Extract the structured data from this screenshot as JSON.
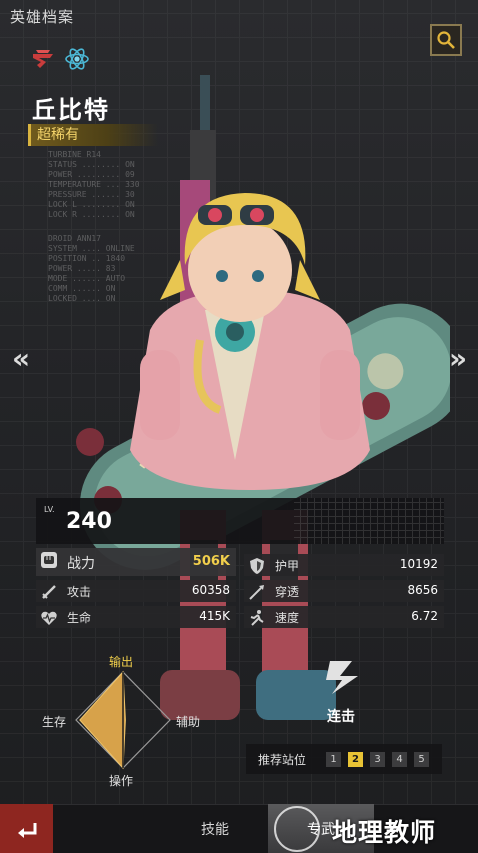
{
  "header": {
    "title": "英雄档案",
    "search_icon": "magnifier-icon"
  },
  "hero": {
    "name": "丘比特",
    "rarity": "超稀有",
    "class_icons": [
      "faction-emblem-icon",
      "atom-type-icon"
    ]
  },
  "nav": {
    "prev": "«",
    "next": "»"
  },
  "stats": {
    "level_label": "LV.",
    "level": "240",
    "power": {
      "label": "战力",
      "value": "506K",
      "icon": "fist-icon"
    },
    "armor": {
      "label": "护甲",
      "value": "10192",
      "icon": "shield-icon"
    },
    "attack": {
      "label": "攻击",
      "value": "60358",
      "icon": "sword-icon"
    },
    "pierce": {
      "label": "穿透",
      "value": "8656",
      "icon": "spear-icon"
    },
    "health": {
      "label": "生命",
      "value": "415K",
      "icon": "heart-icon"
    },
    "speed": {
      "label": "速度",
      "value": "6.72",
      "icon": "runner-icon"
    }
  },
  "role": {
    "top": "输出",
    "left": "生存",
    "right": "辅助",
    "bottom": "操作",
    "levels": {
      "top": 1.0,
      "right": 0.05,
      "bottom": 1.0,
      "left": 0.9
    }
  },
  "combo": {
    "label": "连击",
    "icon": "lightning-icon"
  },
  "formation": {
    "label": "推荐站位",
    "slots": [
      "1",
      "2",
      "3",
      "4",
      "5"
    ],
    "active": "2"
  },
  "bottom": {
    "back_icon": "return-arrow-icon",
    "tab_skill": "技能",
    "tab_active": "专武"
  },
  "watermark": "地理教师",
  "colors": {
    "accent_gold": "#f1cf4c",
    "back_red": "#8e2620",
    "rarity_gold": "#d9b440"
  }
}
